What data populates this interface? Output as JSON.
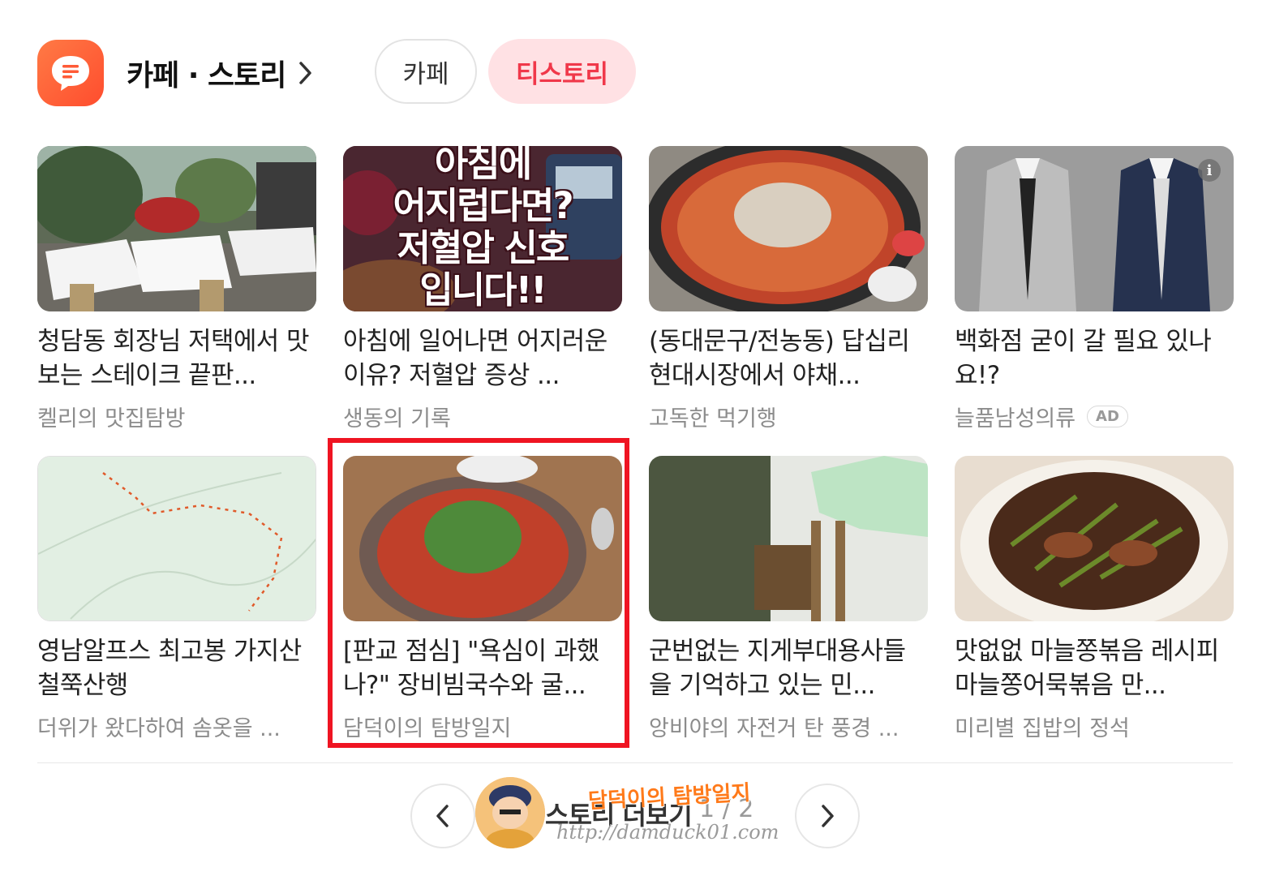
{
  "header": {
    "icon": "chat-bubble-icon",
    "title": "카페 · 스토리",
    "chevron": "chevron-right-icon"
  },
  "tabs": [
    {
      "label": "카페",
      "active": false
    },
    {
      "label": "티스토리",
      "active": true
    }
  ],
  "cards": [
    {
      "title": "청담동 회장님 저택에서 맛 보는 스테이크 끝판...",
      "source": "켈리의 맛집탐방"
    },
    {
      "title": "아침에 일어나면 어지러운 이유? 저혈압 증상 ...",
      "source": "생동의 기록",
      "thumb_text": [
        "아침에",
        "어지럽다면?",
        "저혈압 신호",
        "입니다!!"
      ]
    },
    {
      "title": "(동대문구/전농동) 답십리 현대시장에서 야채...",
      "source": "고독한 먹기행"
    },
    {
      "title": "백화점 굳이 갈 필요 있나요!?",
      "source": "늘품남성의류",
      "ad": "AD",
      "info_icon": "i"
    },
    {
      "title": "영남알프스 최고봉 가지산 철쭉산행",
      "source": "더위가 왔다하여 솜옷을 ..."
    },
    {
      "title": "[판교 점심] \"욕심이 과했나?\" 장비빔국수와 굴...",
      "source": "담덕이의 탐방일지"
    },
    {
      "title": "군번없는 지게부대용사들을 기억하고 있는 민...",
      "source": "앙비야의 자전거 탄 풍경 ..."
    },
    {
      "title": "맛없없 마늘쫑볶음 레시피 마늘쫑어묵볶음 만...",
      "source": "미리별 집밥의 정석"
    }
  ],
  "pager": {
    "prev_icon": "chevron-left-icon",
    "next_icon": "chevron-right-icon",
    "label": "스토리 더보기",
    "current": "1",
    "separator": "/",
    "total": "2"
  },
  "watermark": {
    "name": "담덕이의 탐방일지",
    "url": "http://damduck01.com"
  },
  "colors": {
    "accent": "#f0384a",
    "highlight": "#ef1422",
    "icon_orange": "#ff5a36"
  }
}
